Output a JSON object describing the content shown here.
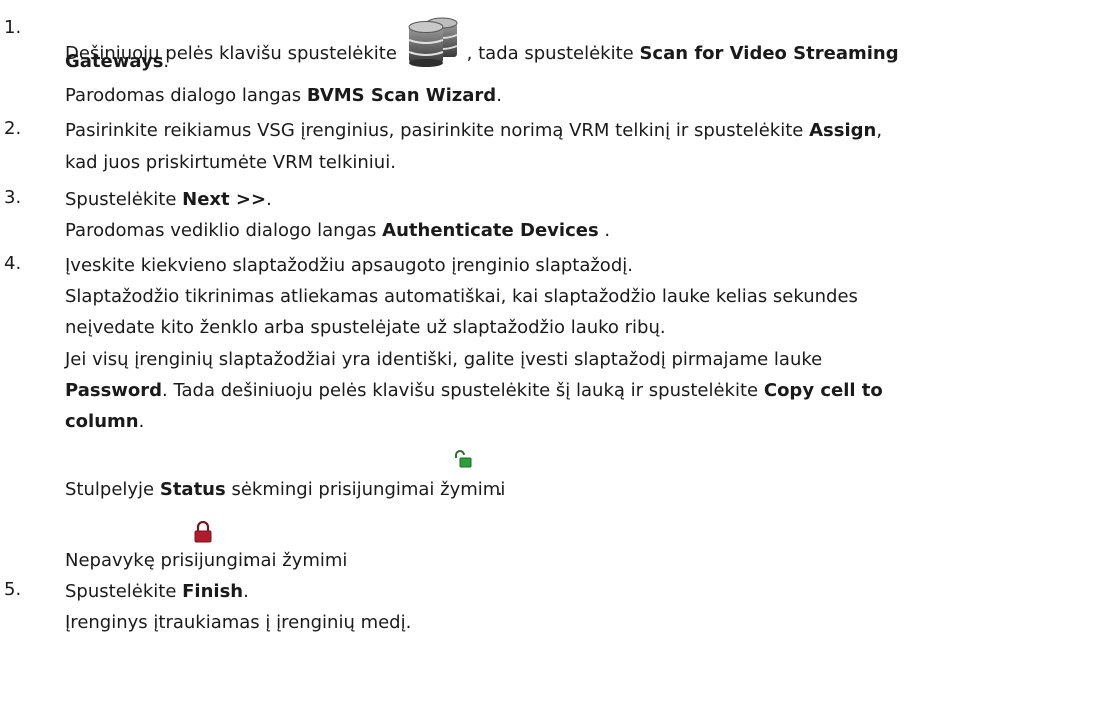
{
  "steps": [
    {
      "number": "1.",
      "lines": {
        "a_pre": "Dešiniuoju pelės klavišu spustelėkite",
        "a_post": ", tada spustelėkite",
        "a_bold": "Scan for Video Streaming",
        "b_bold": "Gateways",
        "b_post": ".",
        "c_pre": "Parodomas dialogo langas",
        "c_bold": "BVMS Scan Wizard",
        "c_post": "."
      }
    },
    {
      "number": "2.",
      "lines": {
        "a_pre": "Pasirinkite reikiamus VSG įrenginius, pasirinkite norimą VRM telkinį ir spustelėkite",
        "a_bold": "Assign",
        "a_post": ",",
        "b": "kad juos priskirtumėte VRM telkiniui."
      }
    },
    {
      "number": "3.",
      "lines": {
        "a_pre": "Spustelėkite",
        "a_bold": "Next >>",
        "a_post": ".",
        "b_pre": "Parodomas vediklio dialogo langas",
        "b_bold": "Authenticate Devices",
        "b_post": " ."
      }
    },
    {
      "number": "4.",
      "lines": {
        "a": "Įveskite kiekvieno slaptažodžiu apsaugoto įrenginio slaptažodį.",
        "b": "Slaptažodžio tikrinimas atliekamas automatiškai, kai slaptažodžio lauke kelias sekundes",
        "c": "neįvedate kito ženklo arba spustelėjate už slaptažodžio lauko ribų.",
        "d": "Jei visų įrenginių slaptažodžiai yra identiški, galite įvesti slaptažodį pirmajame lauke",
        "e_bold": "Password",
        "e_mid": ". Tada dešiniuoju pelės klavišu spustelėkite šį lauką ir spustelėkite",
        "e_bold2": "Copy cell to",
        "f_bold": "column",
        "f_post": ".",
        "g_pre": "Stulpelyje",
        "g_bold": "Status",
        "g_post": "sėkmingi prisijungimai žymimi",
        "g_end": ".",
        "h_pre": "Nepavykę prisijungimai žymimi",
        "h_end": "."
      }
    },
    {
      "number": "5.",
      "lines": {
        "a_pre": "Spustelėkite",
        "a_bold": "Finish",
        "a_post": ".",
        "b": "Įrenginys įtraukiamas į įrenginių medį."
      }
    }
  ],
  "icons": {
    "database": "database-icon",
    "unlocked": "lock-open-icon",
    "locked": "lock-closed-icon"
  },
  "colors": {
    "text": "#1a1a1a",
    "unlock_green": "#2e9e3a",
    "lock_red": "#b01c2a"
  }
}
